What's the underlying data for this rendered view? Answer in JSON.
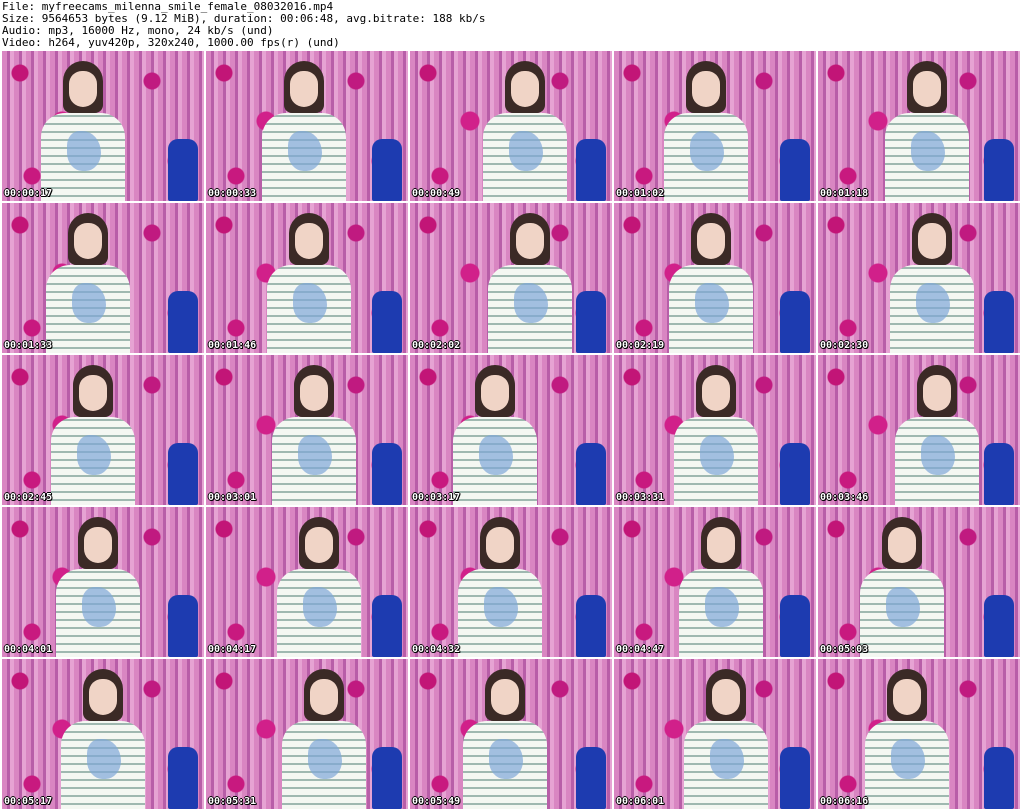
{
  "header": {
    "file": "File: myfreecams_milenna_smile_female_08032016.mp4",
    "size": "Size: 9564653 bytes (9.12 MiB), duration: 00:06:48, avg.bitrate: 188 kb/s",
    "audio": "Audio: mp3, 16000 Hz, mono, 24 kb/s (und)",
    "video": "Video: h264, yuv420p, 320x240, 1000.00 fps(r) (und)"
  },
  "thumbnails": [
    "00:00:17",
    "00:00:33",
    "00:00:49",
    "00:01:02",
    "00:01:18",
    "00:01:33",
    "00:01:46",
    "00:02:02",
    "00:02:19",
    "00:02:30",
    "00:02:45",
    "00:03:01",
    "00:03:17",
    "00:03:31",
    "00:03:46",
    "00:04:01",
    "00:04:17",
    "00:04:32",
    "00:04:47",
    "00:05:03",
    "00:05:17",
    "00:05:31",
    "00:05:49",
    "00:06:01",
    "00:06:16"
  ]
}
